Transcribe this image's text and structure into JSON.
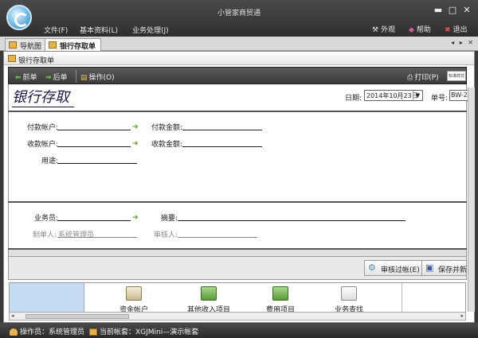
{
  "window": {
    "title": "小管家商贸通",
    "menu": [
      "文件(F)",
      "基本资料(L)",
      "业务处理(J)"
    ],
    "tools": {
      "skin": "外观",
      "help": "帮助",
      "exit": "退出"
    },
    "controls": {
      "minimize": "▬",
      "maximize": "□",
      "close": "✕"
    }
  },
  "tabs": [
    {
      "label": "导航图",
      "active": false
    },
    {
      "label": "银行存取单",
      "active": true
    }
  ],
  "tab_controls": "◂ ▸ ✕",
  "document": {
    "header_title": "银行存取单",
    "toolbar": {
      "prev": "前单",
      "next": "后单",
      "operate": "操作(O)",
      "print": "打印(P)",
      "style": "标准样式"
    },
    "form_title": "银行存取",
    "date_label": "日期:",
    "date_value": "2014年10月23日",
    "number_label": "单号:",
    "number_value": "BW-2",
    "fields": {
      "pay_account": "付款帐户:",
      "pay_amount": "付款金额:",
      "recv_account": "收款帐户:",
      "recv_amount": "收款金额:",
      "purpose": "用途:",
      "salesman": "业务员:",
      "summary": "摘要:",
      "maker": "制单人:",
      "maker_value": "系统管理员",
      "auditor": "审核人:"
    },
    "buttons": {
      "audit": "审核过帐(E)",
      "save_new": "保存并新建"
    }
  },
  "nav_items": [
    "资金帐户",
    "其他收入项目",
    "费用项目",
    "业务查找"
  ],
  "status": {
    "operator": "操作员：系统管理员",
    "account_set": "当前帐套：XGJMini—演示帐套"
  },
  "colors": {
    "chrome_dark": "#3a3a3a",
    "nav_blue": "#c6dbf4",
    "arrow_green": "#7fd84f"
  }
}
